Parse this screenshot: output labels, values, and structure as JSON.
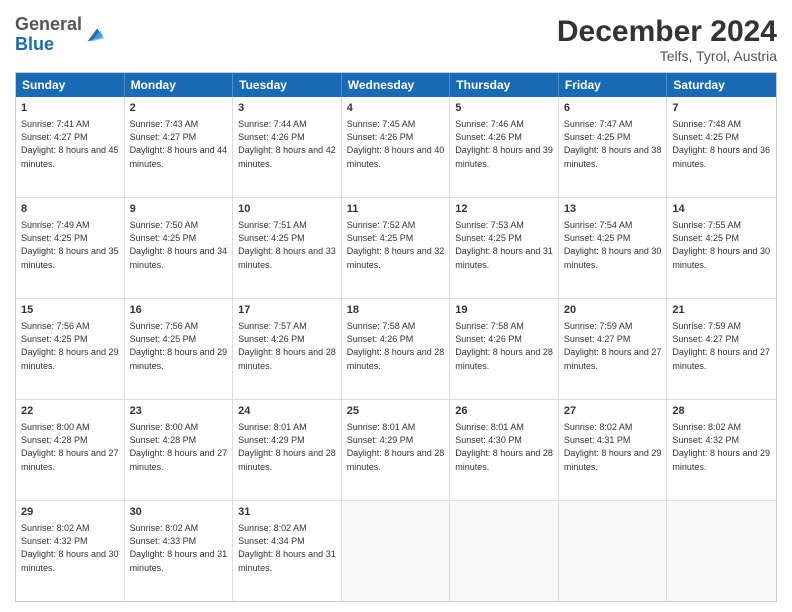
{
  "logo": {
    "general": "General",
    "blue": "Blue"
  },
  "title": "December 2024",
  "location": "Telfs, Tyrol, Austria",
  "header_days": [
    "Sunday",
    "Monday",
    "Tuesday",
    "Wednesday",
    "Thursday",
    "Friday",
    "Saturday"
  ],
  "weeks": [
    [
      {
        "day": "1",
        "sunrise": "7:41 AM",
        "sunset": "4:27 PM",
        "daylight": "8 hours and 45 minutes."
      },
      {
        "day": "2",
        "sunrise": "7:43 AM",
        "sunset": "4:27 PM",
        "daylight": "8 hours and 44 minutes."
      },
      {
        "day": "3",
        "sunrise": "7:44 AM",
        "sunset": "4:26 PM",
        "daylight": "8 hours and 42 minutes."
      },
      {
        "day": "4",
        "sunrise": "7:45 AM",
        "sunset": "4:26 PM",
        "daylight": "8 hours and 40 minutes."
      },
      {
        "day": "5",
        "sunrise": "7:46 AM",
        "sunset": "4:26 PM",
        "daylight": "8 hours and 39 minutes."
      },
      {
        "day": "6",
        "sunrise": "7:47 AM",
        "sunset": "4:25 PM",
        "daylight": "8 hours and 38 minutes."
      },
      {
        "day": "7",
        "sunrise": "7:48 AM",
        "sunset": "4:25 PM",
        "daylight": "8 hours and 36 minutes."
      }
    ],
    [
      {
        "day": "8",
        "sunrise": "7:49 AM",
        "sunset": "4:25 PM",
        "daylight": "8 hours and 35 minutes."
      },
      {
        "day": "9",
        "sunrise": "7:50 AM",
        "sunset": "4:25 PM",
        "daylight": "8 hours and 34 minutes."
      },
      {
        "day": "10",
        "sunrise": "7:51 AM",
        "sunset": "4:25 PM",
        "daylight": "8 hours and 33 minutes."
      },
      {
        "day": "11",
        "sunrise": "7:52 AM",
        "sunset": "4:25 PM",
        "daylight": "8 hours and 32 minutes."
      },
      {
        "day": "12",
        "sunrise": "7:53 AM",
        "sunset": "4:25 PM",
        "daylight": "8 hours and 31 minutes."
      },
      {
        "day": "13",
        "sunrise": "7:54 AM",
        "sunset": "4:25 PM",
        "daylight": "8 hours and 30 minutes."
      },
      {
        "day": "14",
        "sunrise": "7:55 AM",
        "sunset": "4:25 PM",
        "daylight": "8 hours and 30 minutes."
      }
    ],
    [
      {
        "day": "15",
        "sunrise": "7:56 AM",
        "sunset": "4:25 PM",
        "daylight": "8 hours and 29 minutes."
      },
      {
        "day": "16",
        "sunrise": "7:56 AM",
        "sunset": "4:25 PM",
        "daylight": "8 hours and 29 minutes."
      },
      {
        "day": "17",
        "sunrise": "7:57 AM",
        "sunset": "4:26 PM",
        "daylight": "8 hours and 28 minutes."
      },
      {
        "day": "18",
        "sunrise": "7:58 AM",
        "sunset": "4:26 PM",
        "daylight": "8 hours and 28 minutes."
      },
      {
        "day": "19",
        "sunrise": "7:58 AM",
        "sunset": "4:26 PM",
        "daylight": "8 hours and 28 minutes."
      },
      {
        "day": "20",
        "sunrise": "7:59 AM",
        "sunset": "4:27 PM",
        "daylight": "8 hours and 27 minutes."
      },
      {
        "day": "21",
        "sunrise": "7:59 AM",
        "sunset": "4:27 PM",
        "daylight": "8 hours and 27 minutes."
      }
    ],
    [
      {
        "day": "22",
        "sunrise": "8:00 AM",
        "sunset": "4:28 PM",
        "daylight": "8 hours and 27 minutes."
      },
      {
        "day": "23",
        "sunrise": "8:00 AM",
        "sunset": "4:28 PM",
        "daylight": "8 hours and 27 minutes."
      },
      {
        "day": "24",
        "sunrise": "8:01 AM",
        "sunset": "4:29 PM",
        "daylight": "8 hours and 28 minutes."
      },
      {
        "day": "25",
        "sunrise": "8:01 AM",
        "sunset": "4:29 PM",
        "daylight": "8 hours and 28 minutes."
      },
      {
        "day": "26",
        "sunrise": "8:01 AM",
        "sunset": "4:30 PM",
        "daylight": "8 hours and 28 minutes."
      },
      {
        "day": "27",
        "sunrise": "8:02 AM",
        "sunset": "4:31 PM",
        "daylight": "8 hours and 29 minutes."
      },
      {
        "day": "28",
        "sunrise": "8:02 AM",
        "sunset": "4:32 PM",
        "daylight": "8 hours and 29 minutes."
      }
    ],
    [
      {
        "day": "29",
        "sunrise": "8:02 AM",
        "sunset": "4:32 PM",
        "daylight": "8 hours and 30 minutes."
      },
      {
        "day": "30",
        "sunrise": "8:02 AM",
        "sunset": "4:33 PM",
        "daylight": "8 hours and 31 minutes."
      },
      {
        "day": "31",
        "sunrise": "8:02 AM",
        "sunset": "4:34 PM",
        "daylight": "8 hours and 31 minutes."
      },
      null,
      null,
      null,
      null
    ]
  ],
  "labels": {
    "sunrise": "Sunrise:",
    "sunset": "Sunset:",
    "daylight": "Daylight:"
  }
}
